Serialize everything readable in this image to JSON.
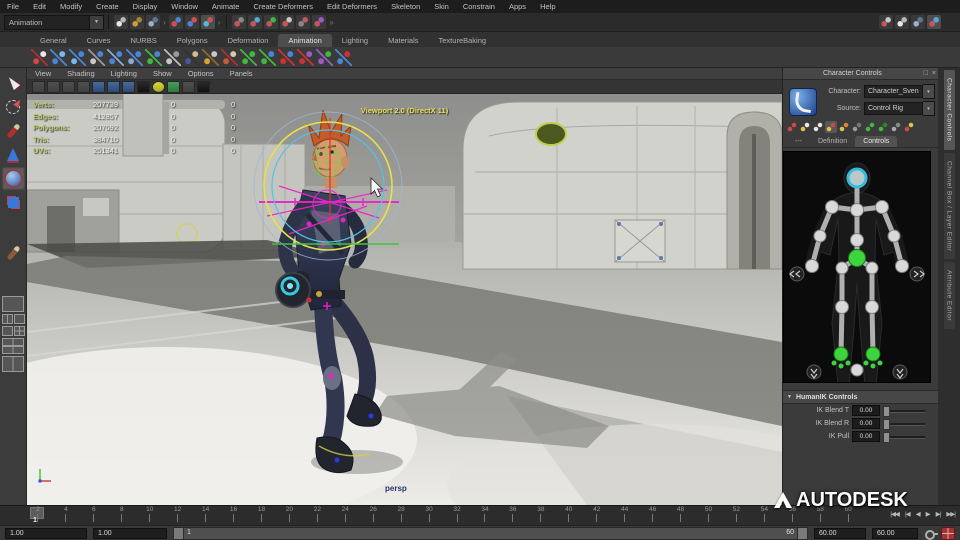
{
  "menu_bar": {
    "items": [
      "File",
      "Edit",
      "Modify",
      "Create",
      "Display",
      "Window",
      "Animate",
      "Create Deformers",
      "Edit Deformers",
      "Skeleton",
      "Skin",
      "Constrain",
      "Apps",
      "Help"
    ]
  },
  "status_line": {
    "mode": "Animation"
  },
  "shelf": {
    "tabs": [
      "General",
      "Curves",
      "NURBS",
      "Polygons",
      "Deformation",
      "Animation",
      "Lighting",
      "Materials",
      "TextureBaking"
    ],
    "active_tab": "Animation"
  },
  "viewport": {
    "menu_items": [
      "View",
      "Shading",
      "Lighting",
      "Show",
      "Options",
      "Panels"
    ],
    "renderer_label": "Viewport 2.0 (DirectX 11)",
    "camera_label": "persp",
    "hud_rows": [
      {
        "label": "Verts:",
        "v1": "207739",
        "v2": "0",
        "v3": "0"
      },
      {
        "label": "Edges:",
        "v1": "412857",
        "v2": "0",
        "v3": "0"
      },
      {
        "label": "Polygons:",
        "v1": "207092",
        "v2": "0",
        "v3": "0"
      },
      {
        "label": "Tris:",
        "v1": "384710",
        "v2": "0",
        "v3": "0"
      },
      {
        "label": "UVs:",
        "v1": "251341",
        "v2": "0",
        "v3": "0"
      }
    ]
  },
  "character_controls": {
    "title": "Character Controls",
    "character_label": "Character:",
    "character_value": "Character_Sven",
    "source_label": "Source:",
    "source_value": "Control Rig",
    "tabs": [
      "---",
      "Definition",
      "Controls"
    ],
    "active_tab": "Controls",
    "humanik": {
      "title": "HumanIK Controls",
      "fields": [
        {
          "label": "IK Blend T",
          "value": "0.00"
        },
        {
          "label": "IK Blend R",
          "value": "0.00"
        },
        {
          "label": "IK Pull",
          "value": "0.00"
        }
      ]
    }
  },
  "side_tabs": {
    "items": [
      "Character Controls",
      "Channel Box / Layer Editor",
      "Attribute Editor"
    ],
    "active": "Character Controls"
  },
  "timeline": {
    "tick_labels": [
      "2",
      "4",
      "6",
      "8",
      "10",
      "12",
      "14",
      "16",
      "18",
      "20",
      "22",
      "24",
      "26",
      "28",
      "30",
      "32",
      "34",
      "36",
      "38",
      "40",
      "42",
      "44",
      "46",
      "48",
      "50",
      "52",
      "54",
      "56",
      "58",
      "60"
    ],
    "current_frame": "1",
    "transport": [
      "|◀◀",
      "|◀",
      "◀",
      "▶",
      "▶|",
      "▶▶|"
    ]
  },
  "range_bar": {
    "playback_start": "1.00",
    "anim_start": "1.00",
    "range_start": "1",
    "range_end": "60",
    "anim_end": "60.00",
    "playback_end": "60.00"
  },
  "watermark": "AUTODESK",
  "icons": {
    "dropdown_arrow": "▼",
    "close": "×",
    "undock": "□",
    "collapse_arrow": "▼"
  }
}
